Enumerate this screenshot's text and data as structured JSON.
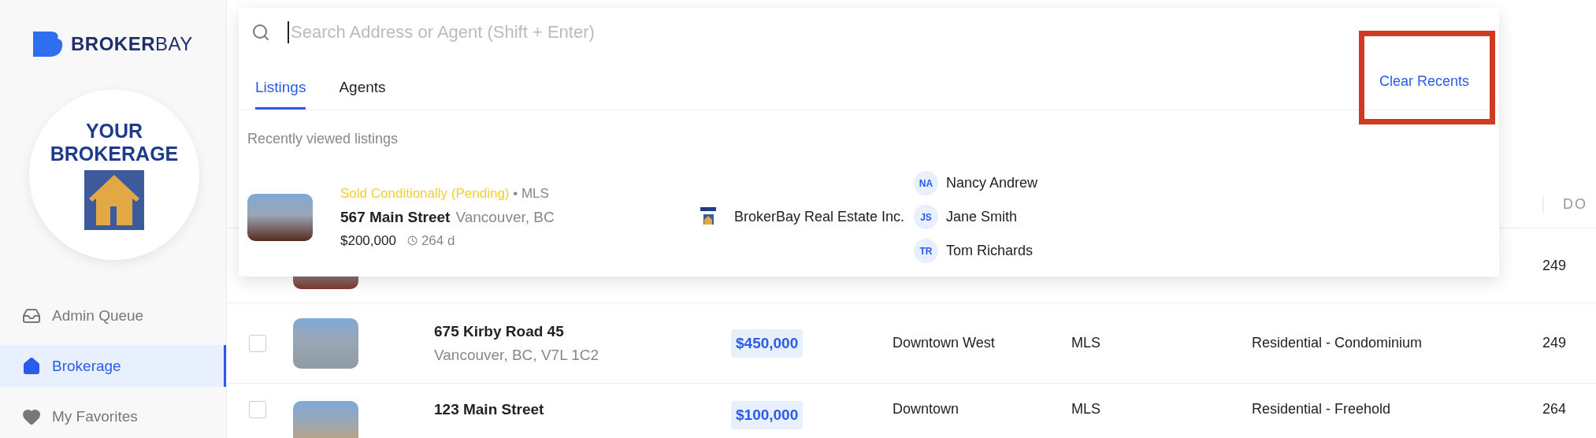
{
  "brand": {
    "name_bold": "BROKER",
    "name_light": "BAY"
  },
  "brokerage_logo": {
    "line_1": "YOUR",
    "line_2": "BROKERAGE"
  },
  "sidebar": {
    "items": [
      {
        "label": "Admin Queue",
        "kind": "inbox",
        "selected": false
      },
      {
        "label": "Brokerage",
        "kind": "home",
        "selected": true
      },
      {
        "label": "My Favorites",
        "kind": "heart",
        "selected": false
      }
    ]
  },
  "table": {
    "header": {
      "column_dom": "DO"
    },
    "rows": [
      {
        "kind": "covered",
        "dom": "249"
      },
      {
        "kind": "full",
        "checked": false,
        "address": "675 Kirby Road 45",
        "city": "Vancouver, BC, V7L 1C2",
        "price": "$450,000",
        "area": "Downtown West",
        "source": "MLS",
        "type": "Residential - Condominium",
        "dom": "249"
      },
      {
        "kind": "partial",
        "checked": false,
        "address": "123 Main Street",
        "price": "$100,000",
        "area": "Downtown",
        "source": "MLS",
        "type": "Residential - Freehold",
        "dom": "264"
      }
    ]
  },
  "search": {
    "placeholder": "Search Address or Agent (Shift + Enter)",
    "tabs": [
      {
        "label": "Listings",
        "selected": true
      },
      {
        "label": "Agents",
        "selected": false
      }
    ],
    "clear_button": "Clear Recents",
    "clear_highlighted": true,
    "section_title": "Recently viewed listings",
    "recent": [
      {
        "status": "Sold Conditionally (Pending)",
        "separator": "•",
        "source": "MLS",
        "address": "567 Main Street",
        "city": "Vancouver, BC",
        "price": "$200,000",
        "days": "264 d",
        "brokerage": "BrokerBay Real Estate Inc.",
        "agents": [
          {
            "initials": "NA",
            "name": "Nancy Andrew"
          },
          {
            "initials": "JS",
            "name": "Jane Smith"
          },
          {
            "initials": "TR",
            "name": "Tom Richards"
          }
        ]
      }
    ]
  }
}
